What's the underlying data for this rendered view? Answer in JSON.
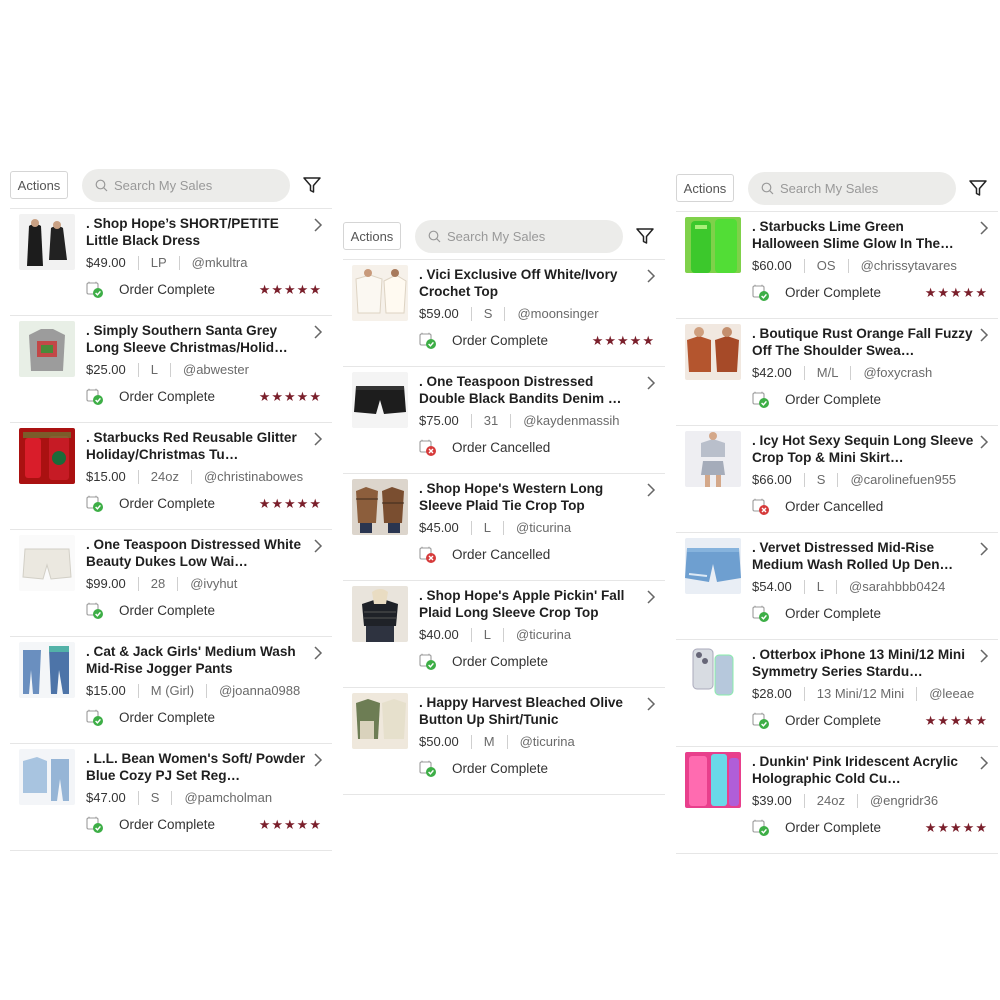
{
  "colors": {
    "accent_star": "#7a1f2b",
    "complete_green": "#3dae46",
    "cancel_red": "#d63b3b",
    "search_bg": "#ececea"
  },
  "toolbar": {
    "actions_label": "Actions",
    "search_placeholder": "Search My Sales",
    "search_icon": "search-icon",
    "filter_icon": "filter-icon"
  },
  "panels": [
    {
      "items": [
        {
          "title": ". Shop Hope’s SHORT/PETITE Little Black Dress",
          "price": "$49.00",
          "size": "LP",
          "user": "@mkultra",
          "status": "Order Complete",
          "status_type": "complete",
          "stars": "★★★★★",
          "thumb": "black-dress"
        },
        {
          "title": ". Simply Southern Santa Grey Long Sleeve Christmas/Holid…",
          "price": "$25.00",
          "size": "L",
          "user": "@abwester",
          "status": "Order Complete",
          "status_type": "complete",
          "stars": "★★★★★",
          "thumb": "grey-top"
        },
        {
          "title": ". Starbucks Red Reusable Glitter Holiday/Christmas Tu…",
          "price": "$15.00",
          "size": "24oz",
          "user": "@christinabowes",
          "status": "Order Complete",
          "status_type": "complete",
          "stars": "★★★★★",
          "thumb": "red-tumbler"
        },
        {
          "title": ". One Teaspoon Distressed White Beauty Dukes Low Wai…",
          "price": "$99.00",
          "size": "28",
          "user": "@ivyhut",
          "status": "Order Complete",
          "status_type": "complete",
          "stars": "",
          "thumb": "white-shorts"
        },
        {
          "title": ". Cat & Jack Girls' Medium Wash Mid-Rise Jogger Pants",
          "price": "$15.00",
          "size": "M (Girl)",
          "user": "@joanna0988",
          "status": "Order Complete",
          "status_type": "complete",
          "stars": "",
          "thumb": "jeans"
        },
        {
          "title": ". L.L. Bean Women's Soft/ Powder Blue Cozy PJ Set Reg…",
          "price": "$47.00",
          "size": "S",
          "user": "@pamcholman",
          "status": "Order Complete",
          "status_type": "complete",
          "stars": "★★★★★",
          "thumb": "blue-pj"
        }
      ]
    },
    {
      "items": [
        {
          "title": ". Vici Exclusive Off White/Ivory Crochet Top",
          "price": "$59.00",
          "size": "S",
          "user": "@moonsinger",
          "status": "Order Complete",
          "status_type": "complete",
          "stars": "★★★★★",
          "thumb": "crochet-top"
        },
        {
          "title": ". One Teaspoon Distressed Double Black Bandits Denim …",
          "price": "$75.00",
          "size": "31",
          "user": "@kaydenmassih",
          "status": "Order Cancelled",
          "status_type": "cancelled",
          "stars": "",
          "thumb": "black-shorts"
        },
        {
          "title": ". Shop Hope's Western Long Sleeve Plaid Tie Crop Top",
          "price": "$45.00",
          "size": "L",
          "user": "@ticurina",
          "status": "Order Cancelled",
          "status_type": "cancelled",
          "stars": "",
          "thumb": "plaid-top"
        },
        {
          "title": ". Shop Hope's Apple Pickin' Fall Plaid Long Sleeve Crop Top",
          "price": "$40.00",
          "size": "L",
          "user": "@ticurina",
          "status": "Order Complete",
          "status_type": "complete",
          "stars": "",
          "thumb": "dark-plaid"
        },
        {
          "title": ". Happy Harvest Bleached Olive Button Up Shirt/Tunic",
          "price": "$50.00",
          "size": "M",
          "user": "@ticurina",
          "status": "Order Complete",
          "status_type": "complete",
          "stars": "",
          "thumb": "olive-shirt"
        }
      ]
    },
    {
      "items": [
        {
          "title": ". Starbucks Lime Green Halloween Slime Glow In The…",
          "price": "$60.00",
          "size": "OS",
          "user": "@chrissytavares",
          "status": "Order Complete",
          "status_type": "complete",
          "stars": "★★★★★",
          "thumb": "lime-cup"
        },
        {
          "title": ". Boutique Rust Orange Fall Fuzzy Off The Shoulder Swea…",
          "price": "$42.00",
          "size": "M/L",
          "user": "@foxycrash",
          "status": "Order Complete",
          "status_type": "complete",
          "stars": "",
          "thumb": "rust-sweater"
        },
        {
          "title": ". Icy Hot Sexy Sequin Long Sleeve Crop Top & Mini Skirt…",
          "price": "$66.00",
          "size": "S",
          "user": "@carolinefuen955",
          "status": "Order Cancelled",
          "status_type": "cancelled",
          "stars": "",
          "thumb": "sequin-set"
        },
        {
          "title": ". Vervet Distressed Mid-Rise Medium Wash Rolled Up Den…",
          "price": "$54.00",
          "size": "L",
          "user": "@sarahbbb0424",
          "status": "Order Complete",
          "status_type": "complete",
          "stars": "",
          "thumb": "denim-shorts"
        },
        {
          "title": ". Otterbox iPhone 13 Mini/12 Mini Symmetry Series Stardu…",
          "price": "$28.00",
          "size": "13 Mini/12 Mini",
          "user": "@leeae",
          "status": "Order Complete",
          "status_type": "complete",
          "stars": "★★★★★",
          "thumb": "phone-case"
        },
        {
          "title": ". Dunkin' Pink Iridescent Acrylic Holographic Cold Cu…",
          "price": "$39.00",
          "size": "24oz",
          "user": "@engridr36",
          "status": "Order Complete",
          "status_type": "complete",
          "stars": "★★★★★",
          "thumb": "pink-cup"
        }
      ]
    }
  ]
}
